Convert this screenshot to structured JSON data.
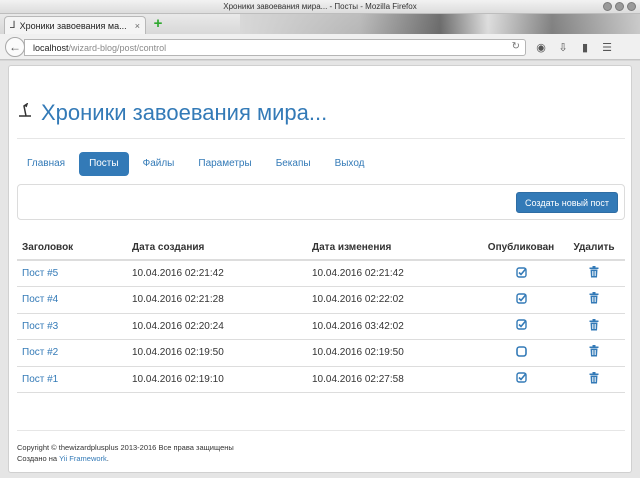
{
  "window": {
    "title": "Хроники завоевания мира... - Посты - Mozilla Firefox"
  },
  "browser": {
    "tab_title": "Хроники завоевания ма...",
    "tab_close": "×",
    "new_tab": "+",
    "url_host": "localhost",
    "url_path": "/wizard-blog/post/control"
  },
  "site": {
    "title": "Хроники завоевания мира..."
  },
  "menu": {
    "items": [
      {
        "label": "Главная"
      },
      {
        "label": "Посты",
        "active": true
      },
      {
        "label": "Файлы"
      },
      {
        "label": "Параметры"
      },
      {
        "label": "Бекапы"
      },
      {
        "label": "Выход"
      }
    ]
  },
  "toolbar": {
    "create_label": "Создать новый пост"
  },
  "table": {
    "headers": [
      "Заголовок",
      "Дата создания",
      "Дата изменения",
      "Опубликован",
      "Удалить"
    ],
    "rows": [
      {
        "title": "Пост #5",
        "created": "10.04.2016 02:21:42",
        "modified": "10.04.2016 02:21:42",
        "published": true
      },
      {
        "title": "Пост #4",
        "created": "10.04.2016 02:21:28",
        "modified": "10.04.2016 02:22:02",
        "published": true
      },
      {
        "title": "Пост #3",
        "created": "10.04.2016 02:20:24",
        "modified": "10.04.2016 03:42:02",
        "published": true
      },
      {
        "title": "Пост #2",
        "created": "10.04.2016 02:19:50",
        "modified": "10.04.2016 02:19:50",
        "published": false
      },
      {
        "title": "Пост #1",
        "created": "10.04.2016 02:19:10",
        "modified": "10.04.2016 02:27:58",
        "published": true
      }
    ]
  },
  "footer": {
    "copyright": "Copyright © thewizardplusplus 2013-2016 Все права защищены",
    "made_with_prefix": "Создано на",
    "framework_link": "Yii Framework",
    "made_with_suffix": "."
  },
  "colors": {
    "accent": "#337ab7"
  }
}
